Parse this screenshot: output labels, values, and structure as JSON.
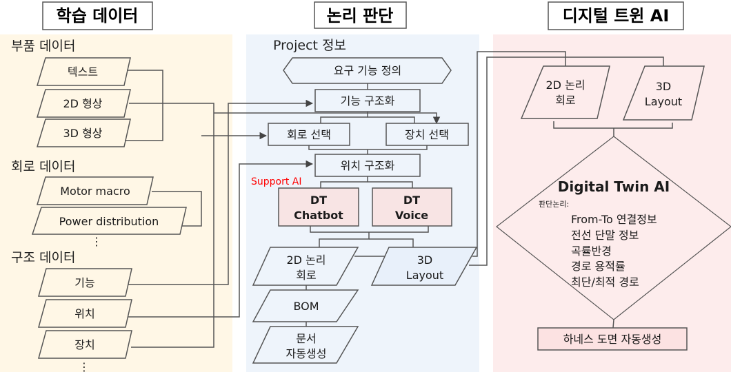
{
  "headers": {
    "learning": "학습 데이터",
    "logic": "논리 판단",
    "digital_twin": "디지털 트윈 AI"
  },
  "learning_panel": {
    "parts_section": "부품 데이터",
    "parts_items": [
      "텍스트",
      "2D 형상",
      "3D 형상"
    ],
    "circuit_section": "회로 데이터",
    "circuit_items": [
      "Motor macro",
      "Power distribution"
    ],
    "structure_section": "구조 데이터",
    "structure_items": [
      "기능",
      "위치",
      "장치"
    ],
    "ellipsis": "⋮"
  },
  "logic_panel": {
    "project_label": "Project 정보",
    "requirement": "요구 기능 정의",
    "function_structuring": "기능 구조화",
    "circuit_select": "회로 선택",
    "device_select": "장치 선택",
    "location_structuring": "위치 구조화",
    "support_ai_label": "Support AI",
    "dt_chatbot": [
      "DT",
      "Chatbot"
    ],
    "dt_voice": [
      "DT",
      "Voice"
    ],
    "logic_circuit_2d": [
      "2D 논리",
      "회로"
    ],
    "layout_3d": [
      "3D",
      "Layout"
    ],
    "bom": "BOM",
    "doc_autogen": [
      "문서",
      "자동생성"
    ]
  },
  "dt_panel": {
    "logic_circuit_2d": [
      "2D 논리",
      "회로"
    ],
    "layout_3d": [
      "3D",
      "Layout"
    ],
    "decision_title": "Digital Twin AI",
    "decision_subtitle": "판단논리:",
    "decision_items": [
      "From-To 연결정보",
      "전선 단말 정보",
      "곡률반경",
      "경로 용적률",
      "최단/최적 경로"
    ],
    "output": "하네스 도면 자동생성"
  },
  "colors": {
    "learning_bg": "#fff7e6",
    "logic_bg": "#eef4fb",
    "dt_bg": "#fdecec",
    "support_ai": "#ff0000",
    "dt_box_fill": "#f8e4e4",
    "line": "#555555"
  }
}
